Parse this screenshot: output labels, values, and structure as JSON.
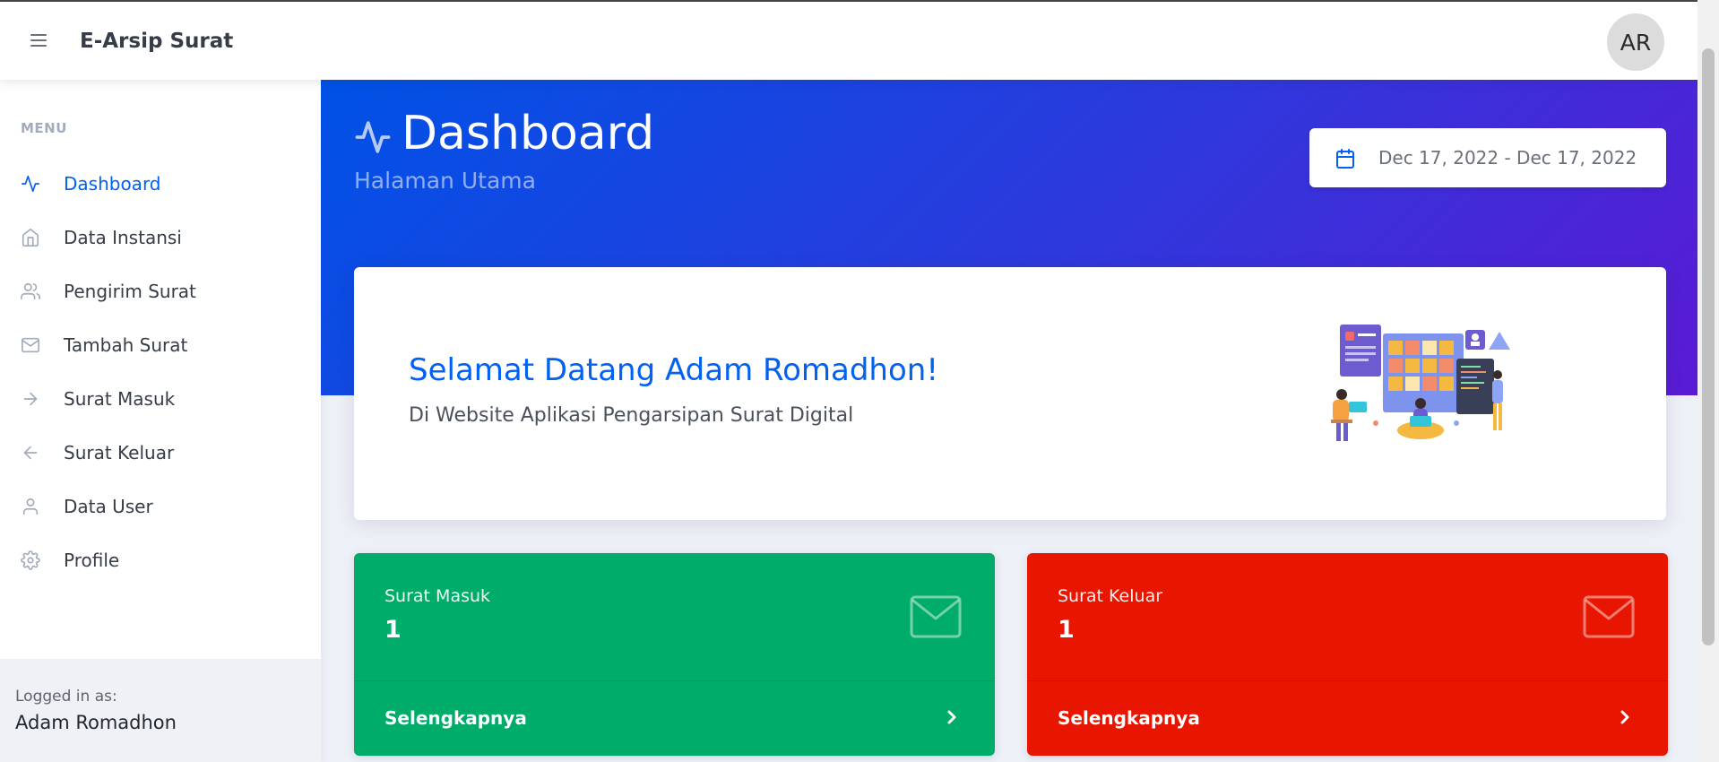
{
  "topbar": {
    "brand": "E-Arsip Surat",
    "avatar_initials": "AR",
    "menu_icon": "hamburger-icon"
  },
  "sidebar": {
    "heading": "MENU",
    "items": [
      {
        "label": "Dashboard",
        "icon": "activity-icon",
        "active": true
      },
      {
        "label": "Data Instansi",
        "icon": "home-icon",
        "active": false
      },
      {
        "label": "Pengirim Surat",
        "icon": "users-icon",
        "active": false
      },
      {
        "label": "Tambah Surat",
        "icon": "mail-icon",
        "active": false
      },
      {
        "label": "Surat Masuk",
        "icon": "arrow-right-icon",
        "active": false
      },
      {
        "label": "Surat Keluar",
        "icon": "arrow-left-icon",
        "active": false
      },
      {
        "label": "Data User",
        "icon": "user-icon",
        "active": false
      },
      {
        "label": "Profile",
        "icon": "settings-icon",
        "active": false
      }
    ],
    "footer": {
      "subtitle": "Logged in as:",
      "name": "Adam Romadhon"
    }
  },
  "header": {
    "title": "Dashboard",
    "subtitle": "Halaman Utama",
    "date_range": "Dec 17, 2022 - Dec 17, 2022"
  },
  "welcome": {
    "title": "Selamat Datang Adam Romadhon!",
    "subtitle": "Di Website Aplikasi Pengarsipan Surat Digital"
  },
  "stats": [
    {
      "title": "Surat Masuk",
      "value": "1",
      "link": "Selengkapnya",
      "color": "#00ac69"
    },
    {
      "title": "Surat Keluar",
      "value": "1",
      "link": "Selengkapnya",
      "color": "#e81500"
    }
  ],
  "colors": {
    "primary": "#0061f2",
    "success": "#00ac69",
    "danger": "#e81500"
  }
}
